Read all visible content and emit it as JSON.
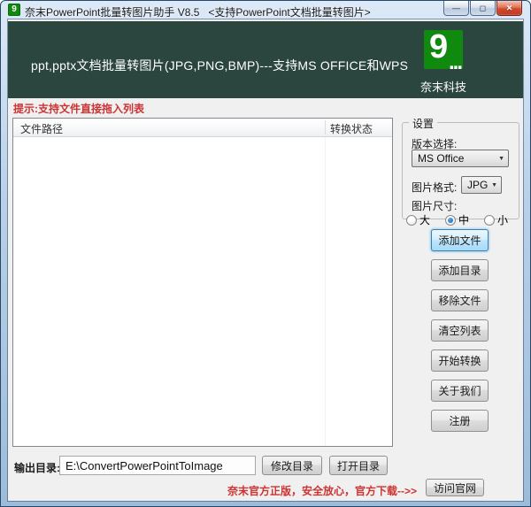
{
  "window": {
    "title": "奈末PowerPoint批量转图片助手 V8.5   <支持PowerPoint文档批量转图片>",
    "controls": {
      "minimize": "—",
      "maximize": "◻",
      "close": "✕"
    }
  },
  "banner": {
    "tagline": "ppt,pptx文档批量转图片(JPG,PNG,BMP)---支持MS OFFICE和WPS",
    "logo_char": "9",
    "logo_dots": "...",
    "brand": "奈末科技",
    "colors": {
      "background": "#2b463f",
      "logo_green": "#0f8a0f"
    }
  },
  "hint": "提示:支持文件直接拖入列表",
  "file_table": {
    "columns": [
      "文件路径",
      "转换状态"
    ],
    "rows": []
  },
  "settings": {
    "group_label": "设置",
    "version_label": "版本选择:",
    "version_value": "MS Office",
    "format_label": "图片格式:",
    "format_value": "JPG",
    "size_label": "图片尺寸:",
    "size_options": [
      {
        "label": "大",
        "selected": false
      },
      {
        "label": "中",
        "selected": true
      },
      {
        "label": "小",
        "selected": false
      }
    ],
    "dropdown_arrow": "▼"
  },
  "actions": {
    "add_file": "添加文件",
    "add_folder": "添加目录",
    "remove_file": "移除文件",
    "clear_list": "清空列表",
    "start_convert": "开始转换",
    "about_us": "关于我们",
    "register": "注册"
  },
  "output": {
    "label": "输出目录:",
    "path": "E:\\ConvertPowerPointToImage",
    "modify_button": "修改目录",
    "open_button": "打开目录"
  },
  "footer": {
    "promo": "奈末官方正版，安全放心，官方下载-->>",
    "visit_button": "访问官网",
    "promo_color": "#cc3333"
  }
}
